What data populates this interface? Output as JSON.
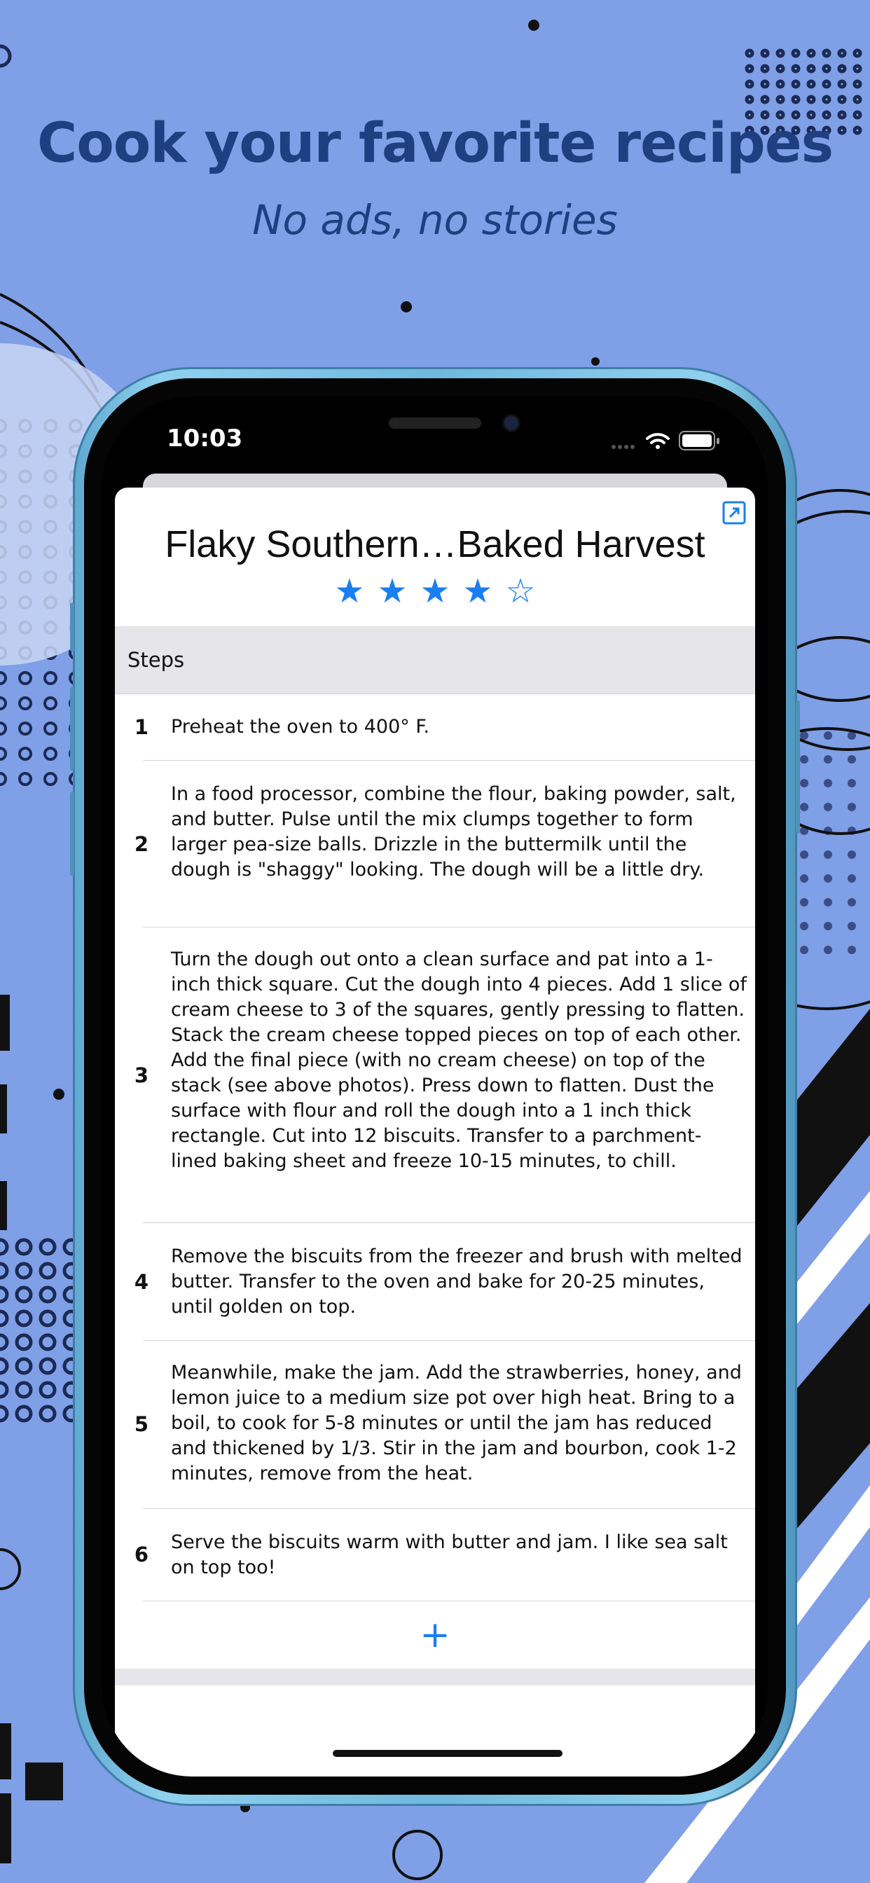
{
  "marketing": {
    "headline": "Cook your favorite recipes",
    "subheadline": "No ads, no stories"
  },
  "status_bar": {
    "time": "10:03"
  },
  "recipe": {
    "title": "Flaky Southern…Baked Harvest",
    "rating": 4,
    "rating_max": 5,
    "star_filled": "★",
    "star_empty": "☆"
  },
  "steps_section": {
    "header": "Steps",
    "steps": [
      {
        "number": "1",
        "text": "Preheat the oven to 400° F."
      },
      {
        "number": "2",
        "text": "In a food processor, combine the flour, baking powder, salt, and butter. Pulse until the mix clumps together to form larger pea-size balls. Drizzle in the buttermilk until the dough is \"shaggy\" looking. The dough will be a little dry."
      },
      {
        "number": "3",
        "text": "Turn the dough out onto a clean surface and pat into a 1-inch thick square. Cut the dough into 4 pieces. Add 1 slice of cream cheese to 3 of the squares, gently pressing to flatten. Stack the cream cheese topped pieces on top of each other. Add the final piece (with no cream cheese) on top of the stack (see above photos). Press down to flatten. Dust the surface with flour and roll the dough into a 1 inch thick rectangle. Cut into 12 biscuits. Transfer to a parchment-lined baking sheet and freeze 10-15 minutes, to chill."
      },
      {
        "number": "4",
        "text": "Remove the biscuits from the freezer and brush with melted butter. Transfer to the oven and bake for 20-25 minutes, until golden on top."
      },
      {
        "number": "5",
        "text": "Meanwhile, make the jam. Add the strawberries, honey, and lemon juice to a medium size pot over high heat. Bring to a boil, to cook for 5-8 minutes or until the jam has reduced and thickened by 1/3. Stir in the jam and bourbon, cook 1-2 minutes, remove from the heat."
      },
      {
        "number": "6",
        "text": "Serve the biscuits warm with butter and jam. I like sea salt on top too!"
      }
    ],
    "add_label": "+"
  },
  "icons": {
    "expand": "expand-icon",
    "wifi": "wifi-icon",
    "battery": "battery-icon",
    "signal": "cellular-signal-icon"
  },
  "colors": {
    "background": "#7f9fe6",
    "headline": "#1f3f80",
    "accent": "#1a7ef0",
    "phone_frame": "#6fb8de"
  }
}
